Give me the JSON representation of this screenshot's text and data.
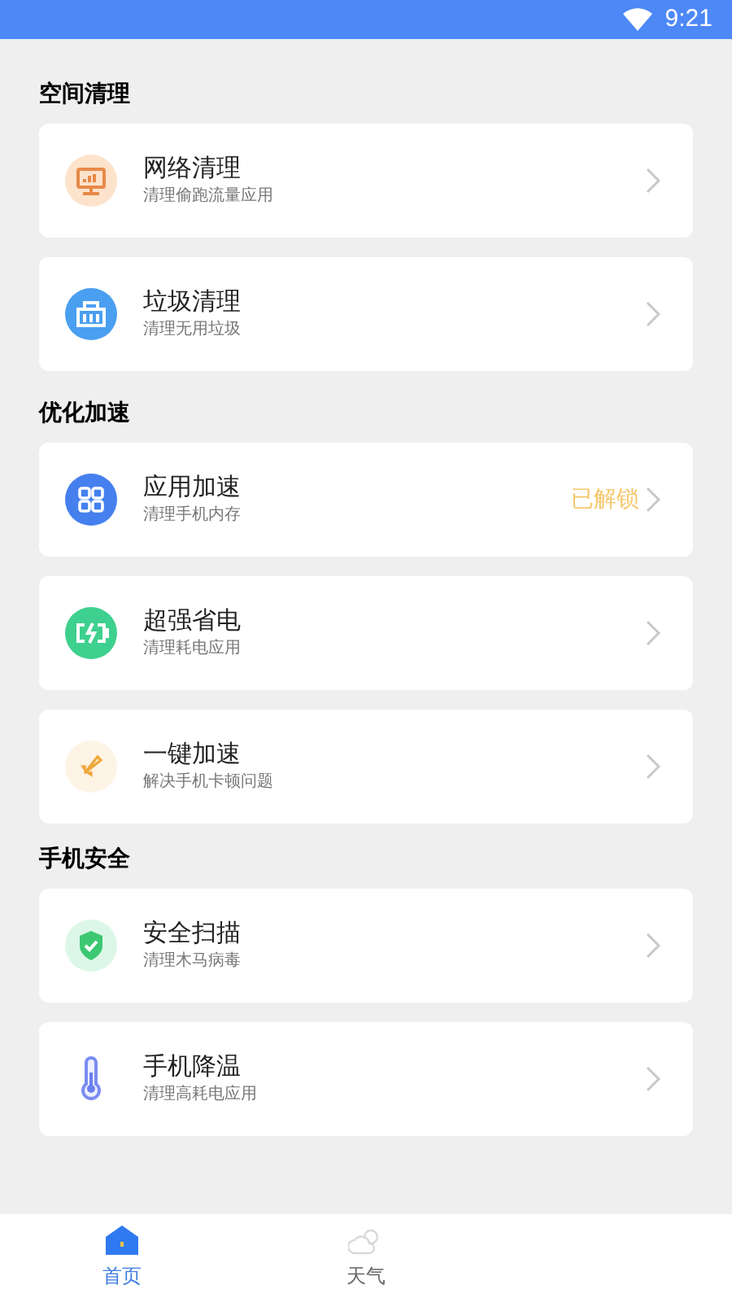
{
  "status_bar": {
    "time": "9:21"
  },
  "sections": [
    {
      "title": "空间清理",
      "items": [
        {
          "title": "网络清理",
          "subtitle": "清理偷跑流量应用"
        },
        {
          "title": "垃圾清理",
          "subtitle": "清理无用垃圾"
        }
      ]
    },
    {
      "title": "优化加速",
      "items": [
        {
          "title": "应用加速",
          "subtitle": "清理手机内存",
          "badge": "已解锁"
        },
        {
          "title": "超强省电",
          "subtitle": "清理耗电应用"
        },
        {
          "title": "一键加速",
          "subtitle": "解决手机卡顿问题"
        }
      ]
    },
    {
      "title": "手机安全",
      "items": [
        {
          "title": "安全扫描",
          "subtitle": "清理木马病毒"
        },
        {
          "title": "手机降温",
          "subtitle": "清理高耗电应用"
        }
      ]
    }
  ],
  "tab_bar": [
    {
      "label": "首页",
      "selected": true
    },
    {
      "label": "天气",
      "selected": false
    }
  ]
}
